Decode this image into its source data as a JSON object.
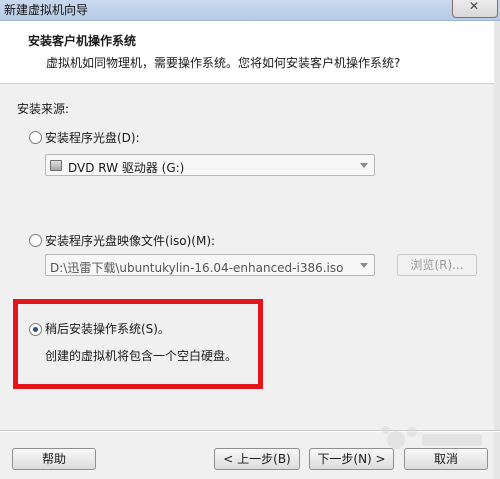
{
  "window": {
    "title": "新建虚拟机向导"
  },
  "header": {
    "title": "安装客户机操作系统",
    "subtitle": "虚拟机如同物理机，需要操作系统。您将如何安装客户机操作系统?"
  },
  "install_source": {
    "label": "安装来源:",
    "options": [
      {
        "label": "安装程序光盘(D):",
        "selected": false
      },
      {
        "label": "安装程序光盘映像文件(iso)(M):",
        "selected": false
      },
      {
        "label": "稍后安装操作系统(S)。",
        "selected": true
      }
    ],
    "disc_drive_value": "DVD RW 驱动器 (G:)",
    "iso_path_value": "D:\\迅雷下载\\ubuntukylin-16.04-enhanced-i386.iso",
    "browse_label": "浏览(R)...",
    "later_description": "创建的虚拟机将包含一个空白硬盘。"
  },
  "footer": {
    "help_label": "帮助",
    "back_label": "< 上一步(B)",
    "next_label": "下一步(N) >",
    "cancel_label": "取消"
  },
  "colors": {
    "highlight": "#e2141c"
  }
}
